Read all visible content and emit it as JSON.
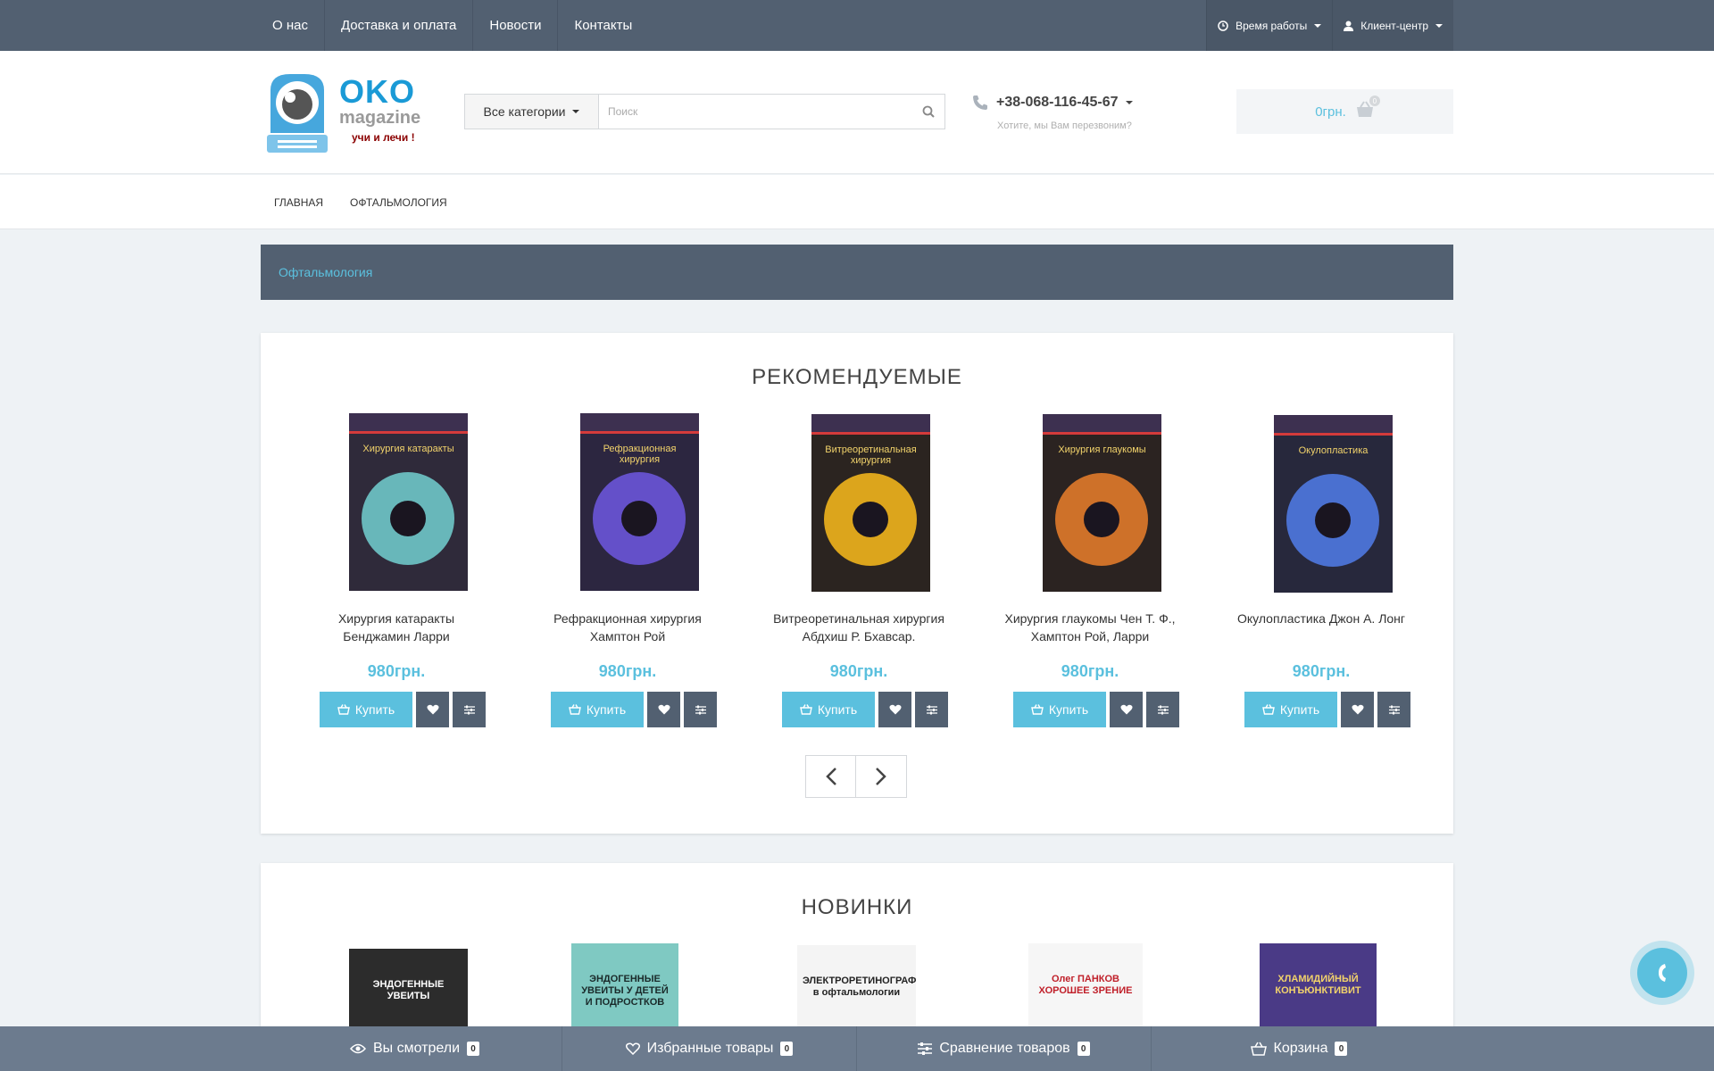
{
  "topbar": {
    "links": [
      "О нас",
      "Доставка и оплата",
      "Новости",
      "Контакты"
    ],
    "work_hours": "Время работы",
    "client_center": "Клиент-центр"
  },
  "header": {
    "logo_title": "OKO",
    "logo_subtitle": "magazine",
    "logo_slogan": "учи и лечи !",
    "search_category": "Все категории",
    "search_placeholder": "Поиск",
    "phone": "+38-068-116-45-67",
    "callback_text": "Хотите, мы Вам перезвоним?",
    "cart_total": "0грн.",
    "cart_count": "0"
  },
  "menu": [
    "Главная",
    "Офтальмология"
  ],
  "breadcrumb": "Офтальмология",
  "recommended": {
    "title": "РЕКОМЕНДУЕМЫЕ",
    "buy_label": "Купить",
    "products": [
      {
        "name_line1": "Хирургия катаракты",
        "name_line2": "Бенджамин Ларри",
        "price": "980грн.",
        "cover_title": "Хирургия катаракты",
        "cover_color": "#2f2a3a",
        "iris": "#6fc6c9"
      },
      {
        "name_line1": "Рефракционная хирургия",
        "name_line2": "Хамптон Рой",
        "price": "980грн.",
        "cover_title": "Рефракционная хирургия",
        "cover_color": "#2c2640",
        "iris": "#6a55d8"
      },
      {
        "name_line1": "Витреоретинальная хирургия",
        "name_line2": "Абдхиш Р. Бхавсар.",
        "price": "980грн.",
        "cover_title": "Витреоретинальная хирургия",
        "cover_color": "#2b2420",
        "iris": "#f0b41c"
      },
      {
        "name_line1": "Хирургия глаукомы Чен Т. Ф.,",
        "name_line2": "Хамптон Рой, Ларри",
        "price": "980грн.",
        "cover_title": "Хирургия глаукомы",
        "cover_color": "#2b2321",
        "iris": "#e07a2a"
      },
      {
        "name_line1": "Окулопластика Джон А. Лонг",
        "name_line2": "",
        "price": "980грн.",
        "cover_title": "Окулопластика",
        "cover_color": "#27283c",
        "iris": "#4f78e0"
      }
    ]
  },
  "new_items": {
    "title": "НОВИНКИ",
    "covers": [
      {
        "text": "ЭНДОГЕННЫЕ УВЕИТЫ",
        "bg": "#2c2c2c",
        "fg": "#ffffff"
      },
      {
        "text": "ЭНДОГЕННЫЕ УВЕИТЫ У ДЕТЕЙ И ПОДРОСТКОВ",
        "bg": "#7fc9c2",
        "fg": "#1a2a2a"
      },
      {
        "text": "ЭЛЕКТРОРЕТИНОГРАФИЯ в офтальмологии",
        "bg": "#f4f4f4",
        "fg": "#222222"
      },
      {
        "text": "Олег ПАНКОВ ХОРОШЕЕ ЗРЕНИЕ",
        "bg": "#f6f6f6",
        "fg": "#c0202a"
      },
      {
        "text": "ХЛАМИДИЙНЫЙ КОНЪЮНКТИВИТ",
        "bg": "#4a3a86",
        "fg": "#f2d36b"
      }
    ]
  },
  "bottombar": {
    "viewed": "Вы смотрели",
    "viewed_count": "0",
    "favorites": "Избранные товары",
    "favorites_count": "0",
    "compare": "Сравнение товаров",
    "compare_count": "0",
    "cart": "Корзина",
    "cart_count": "0"
  },
  "colors": {
    "accent": "#5bc0de",
    "dark": "#526071",
    "bottombar": "#6c7b8e"
  }
}
